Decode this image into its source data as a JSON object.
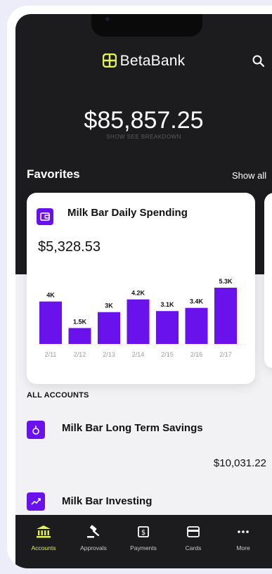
{
  "brand": {
    "name": "BetaBank"
  },
  "balance": {
    "total": "$85,857.25",
    "sub": "SHOW SEE BREAKDOWN"
  },
  "favorites": {
    "title": "Favorites",
    "show_all": "Show all",
    "card": {
      "title": "Milk Bar Daily Spending",
      "amount": "$5,328.53"
    }
  },
  "chart_data": {
    "type": "bar",
    "categories": [
      "2/11",
      "2/12",
      "2/13",
      "2/14",
      "2/15",
      "2/16",
      "2/17"
    ],
    "values": [
      4.0,
      1.5,
      3.0,
      4.2,
      3.1,
      3.4,
      5.3
    ],
    "data_labels": [
      "4K",
      "1.5K",
      "3K",
      "4.2K",
      "3.1K",
      "3.4K",
      "5.3K"
    ],
    "bar_color": "#6a12ec",
    "ylim": [
      0,
      5.3
    ]
  },
  "accounts": {
    "section_label": "ALL ACCOUNTS",
    "items": [
      {
        "name": "Milk Bar Long Term Savings",
        "balance": "$10,031.22",
        "icon": "savings-icon"
      },
      {
        "name": "Milk Bar Investing",
        "balance": "",
        "icon": "investing-icon"
      }
    ]
  },
  "tabs": [
    {
      "label": "Accounts",
      "icon": "bank-icon",
      "active": true
    },
    {
      "label": "Approvals",
      "icon": "gavel-icon",
      "active": false
    },
    {
      "label": "Payments",
      "icon": "payments-icon",
      "active": false
    },
    {
      "label": "Cards",
      "icon": "card-icon",
      "active": false
    },
    {
      "label": "More",
      "icon": "more-icon",
      "active": false
    }
  ],
  "colors": {
    "accent": "#6a12ec",
    "highlight": "#e3f252",
    "dark": "#1c1c1e"
  }
}
